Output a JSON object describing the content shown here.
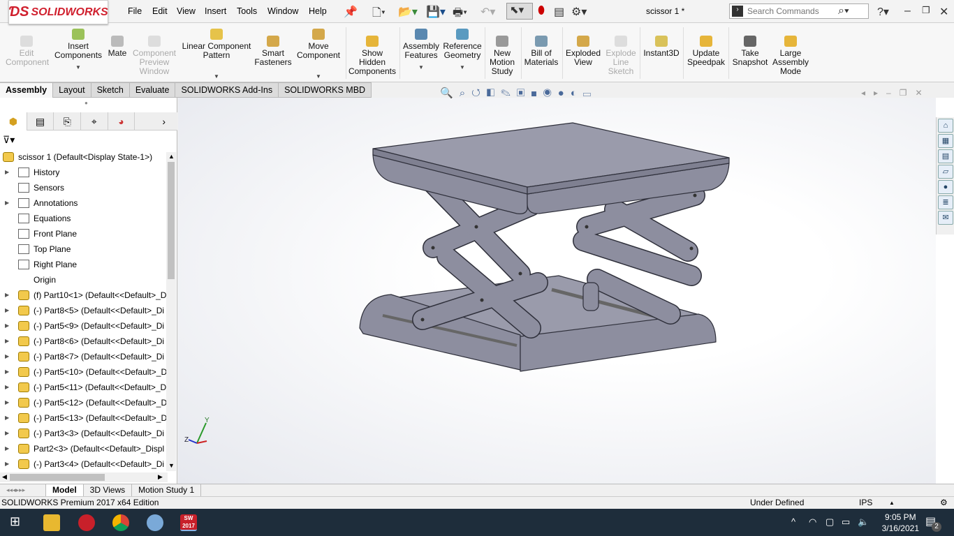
{
  "app": {
    "logo": "SOLIDWORKS",
    "title": "scissor 1 *"
  },
  "menu": [
    "File",
    "Edit",
    "View",
    "Insert",
    "Tools",
    "Window",
    "Help"
  ],
  "search": {
    "placeholder": "Search Commands"
  },
  "ribbon": [
    {
      "label": "Edit Component",
      "disabled": true
    },
    {
      "label": "Insert Components",
      "dropdown": true
    },
    {
      "label": "Mate"
    },
    {
      "label": "Component Preview Window",
      "disabled": true
    },
    {
      "label": "Linear Component Pattern",
      "dropdown": true
    },
    {
      "label": "Smart Fasteners"
    },
    {
      "label": "Move Component",
      "dropdown": true
    },
    {
      "label": "Show Hidden Components"
    },
    {
      "label": "Assembly Features",
      "dropdown": true
    },
    {
      "label": "Reference Geometry",
      "dropdown": true
    },
    {
      "label": "New Motion Study"
    },
    {
      "label": "Bill of Materials"
    },
    {
      "label": "Exploded View"
    },
    {
      "label": "Explode Line Sketch",
      "disabled": true
    },
    {
      "label": "Instant3D"
    },
    {
      "label": "Update Speedpak"
    },
    {
      "label": "Take Snapshot"
    },
    {
      "label": "Large Assembly Mode"
    }
  ],
  "cm_tabs": [
    "Assembly",
    "Layout",
    "Sketch",
    "Evaluate",
    "SOLIDWORKS Add-Ins",
    "SOLIDWORKS MBD"
  ],
  "tree": {
    "root": "scissor 1  (Default<Display State-1>)",
    "items": [
      {
        "label": "History",
        "expand": true,
        "type": "folder"
      },
      {
        "label": "Sensors",
        "type": "folder"
      },
      {
        "label": "Annotations",
        "expand": true,
        "type": "folder"
      },
      {
        "label": "Equations",
        "type": "folder"
      },
      {
        "label": "Front Plane",
        "type": "plane"
      },
      {
        "label": "Top Plane",
        "type": "plane"
      },
      {
        "label": "Right Plane",
        "type": "plane"
      },
      {
        "label": "Origin",
        "type": "origin"
      },
      {
        "label": "(f) Part10<1> (Default<<Default>_D",
        "expand": true,
        "type": "part"
      },
      {
        "label": "(-) Part8<5> (Default<<Default>_Di",
        "expand": true,
        "type": "part"
      },
      {
        "label": "(-) Part5<9> (Default<<Default>_Di",
        "expand": true,
        "type": "part"
      },
      {
        "label": "(-) Part8<6> (Default<<Default>_Di",
        "expand": true,
        "type": "part"
      },
      {
        "label": "(-) Part8<7> (Default<<Default>_Di",
        "expand": true,
        "type": "part"
      },
      {
        "label": "(-) Part5<10> (Default<<Default>_D",
        "expand": true,
        "type": "part"
      },
      {
        "label": "(-) Part5<11> (Default<<Default>_D",
        "expand": true,
        "type": "part"
      },
      {
        "label": "(-) Part5<12> (Default<<Default>_D",
        "expand": true,
        "type": "part"
      },
      {
        "label": "(-) Part5<13> (Default<<Default>_D",
        "expand": true,
        "type": "part"
      },
      {
        "label": "(-) Part3<3> (Default<<Default>_Di",
        "expand": true,
        "type": "part"
      },
      {
        "label": "Part2<3> (Default<<Default>_Displ",
        "expand": true,
        "type": "part"
      },
      {
        "label": "(-) Part3<4> (Default<<Default>_Di",
        "expand": true,
        "type": "part"
      }
    ]
  },
  "bottom_tabs": [
    "Model",
    "3D Views",
    "Motion Study 1"
  ],
  "status": {
    "edition": "SOLIDWORKS Premium 2017 x64 Edition",
    "state": "Under Defined",
    "units": "IPS"
  },
  "triad": {
    "y": "Y",
    "z": "Z"
  },
  "taskbar": {
    "time": "9:05 PM",
    "date": "3/16/2021",
    "notifications": "2",
    "sw_badge": "SW 2017"
  },
  "colors": {
    "model": "#8d8e9f",
    "accent": "#d0202e",
    "taskbar": "#1e2d3b"
  }
}
